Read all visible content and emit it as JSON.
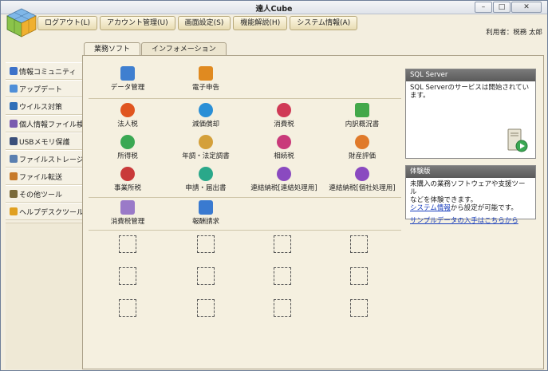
{
  "window": {
    "title": "達人Cube",
    "minimize": "–",
    "maximize": "□",
    "close": "✕"
  },
  "menu": [
    "ログアウト(L)",
    "アカウント管理(U)",
    "画面設定(S)",
    "機能解説(H)",
    "システム情報(A)"
  ],
  "user_label": "利用者：税務 太郎",
  "sidebar": [
    {
      "label": "情報コミュニティ",
      "color": "#3d72c9"
    },
    {
      "label": "アップデート",
      "color": "#4f8fd8"
    },
    {
      "label": "ウイルス対策",
      "color": "#2f6fb8"
    },
    {
      "label": "個人情報ファイル検索",
      "color": "#7a5bb0"
    },
    {
      "label": "USBメモリ保護",
      "color": "#3a4f7a"
    },
    {
      "label": "ファイルストレージ",
      "color": "#5a7fb0"
    },
    {
      "label": "ファイル転送",
      "color": "#c77a2a"
    },
    {
      "label": "その他ツール",
      "color": "#7a6a3a"
    },
    {
      "label": "ヘルプデスクツール",
      "color": "#e0a020"
    }
  ],
  "tabs": [
    "業務ソフト",
    "インフォメーション"
  ],
  "apps": {
    "row1": [
      {
        "label": "データ管理",
        "color": "#3f7fd0"
      },
      {
        "label": "電子申告",
        "color": "#e08a20"
      }
    ],
    "row2": [
      {
        "label": "法人税",
        "color": "#e0551f"
      },
      {
        "label": "減価償却",
        "color": "#2a8fd6"
      },
      {
        "label": "消費税",
        "color": "#d03a56"
      },
      {
        "label": "内訳概況書",
        "color": "#43a84a"
      }
    ],
    "row3": [
      {
        "label": "所得税",
        "color": "#3aa853"
      },
      {
        "label": "年調・法定調書",
        "color": "#d4a03a"
      },
      {
        "label": "相続税",
        "color": "#c93a7a"
      },
      {
        "label": "財産評価",
        "color": "#e07a2a"
      }
    ],
    "row4": [
      {
        "label": "事業所税",
        "color": "#c93a3a"
      },
      {
        "label": "申請・届出書",
        "color": "#2aa88a"
      },
      {
        "label": "連結納税[連結処理用]",
        "color": "#8a4ac0"
      },
      {
        "label": "連結納税[個社処理用]",
        "color": "#8a4ac0"
      }
    ],
    "row5": [
      {
        "label": "消費税管理",
        "color": "#9a7ac8"
      },
      {
        "label": "報酬請求",
        "color": "#3a7ad0"
      }
    ]
  },
  "sql_panel": {
    "title": "SQL Server",
    "message": "SQL Serverのサービスは開始されています。"
  },
  "trial_panel": {
    "title": "体験版",
    "line1": "未購入の業務ソフトウェアや支援ツール",
    "line2": "などを体験できます。",
    "link1": "システム情報",
    "line3": "から設定が可能です。",
    "link2": "サンプルデータの入手はこちらから"
  }
}
